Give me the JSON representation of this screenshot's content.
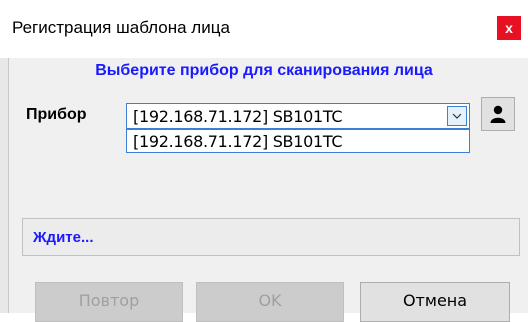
{
  "window": {
    "title": "Регистрация шаблона лица",
    "close_label": "x"
  },
  "subtitle": "Выберите прибор для сканирования лица",
  "device": {
    "label": "Прибор",
    "selected": "[192.168.71.172] SB101TC",
    "options": [
      "[192.168.71.172] SB101TC"
    ]
  },
  "status": {
    "text": "Ждите..."
  },
  "buttons": {
    "repeat": "Повтор",
    "ok": "OK",
    "cancel": "Отмена"
  },
  "colors": {
    "accent_text": "#1a1aff",
    "close_bg": "#e81123"
  }
}
